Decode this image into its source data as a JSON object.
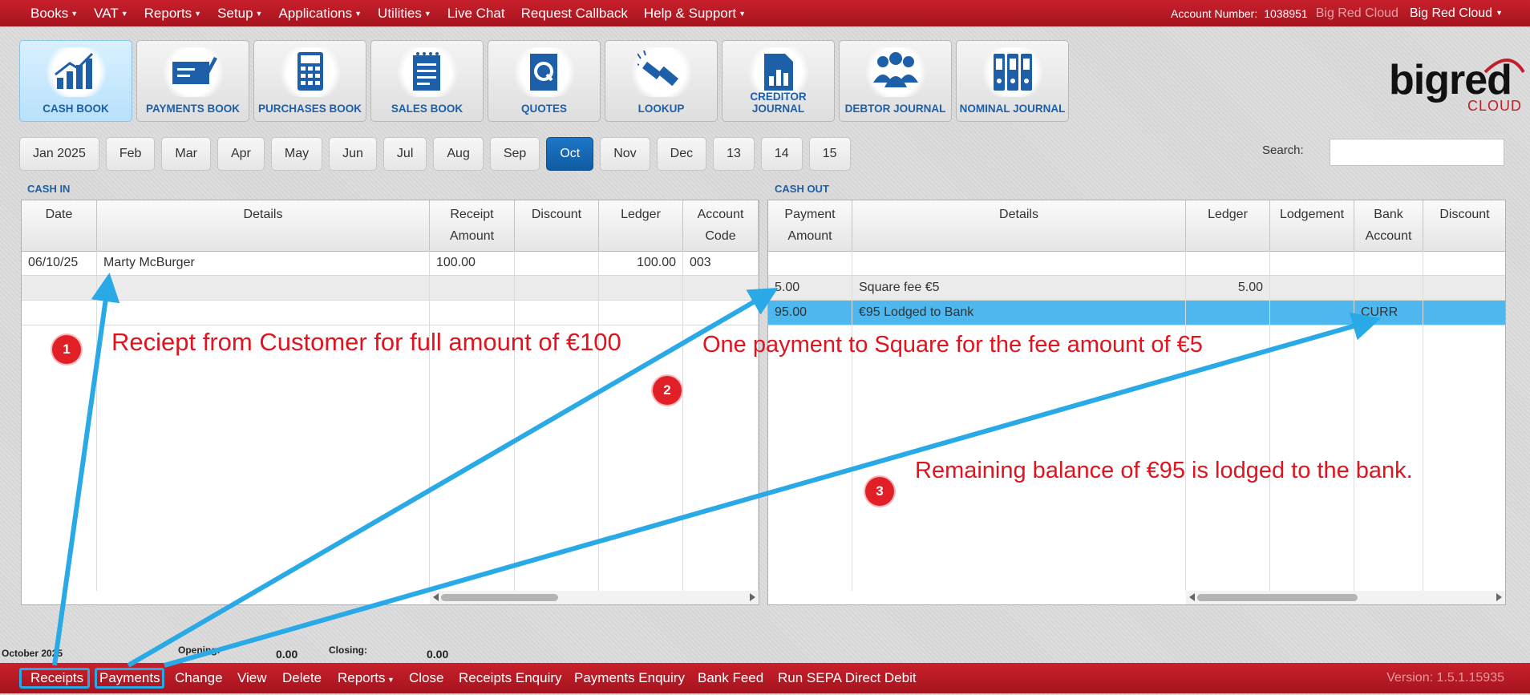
{
  "top_menu": [
    {
      "label": "Books",
      "dropdown": true
    },
    {
      "label": "VAT",
      "dropdown": true
    },
    {
      "label": "Reports",
      "dropdown": true
    },
    {
      "label": "Setup",
      "dropdown": true
    },
    {
      "label": "Applications",
      "dropdown": true
    },
    {
      "label": "Utilities",
      "dropdown": true
    },
    {
      "label": "Live Chat",
      "dropdown": false
    },
    {
      "label": "Request Callback",
      "dropdown": false
    },
    {
      "label": "Help & Support",
      "dropdown": true
    }
  ],
  "account": {
    "number_label": "Account Number:",
    "number": "1038951",
    "company_faded": "Big Red Cloud",
    "company": "Big Red Cloud"
  },
  "books": [
    {
      "label": "CASH BOOK",
      "icon": "bar-chart-icon",
      "active": true
    },
    {
      "label": "PAYMENTS BOOK",
      "icon": "cheque-pen-icon",
      "active": false
    },
    {
      "label": "PURCHASES BOOK",
      "icon": "calculator-icon",
      "active": false
    },
    {
      "label": "SALES BOOK",
      "icon": "notepad-icon",
      "active": false
    },
    {
      "label": "QUOTES",
      "icon": "quote-document-icon",
      "active": false
    },
    {
      "label": "LOOKUP",
      "icon": "flashlight-icon",
      "active": false
    },
    {
      "label": "CREDITOR JOURNAL",
      "icon": "chart-document-icon",
      "active": false
    },
    {
      "label": "DEBTOR JOURNAL",
      "icon": "people-group-icon",
      "active": false
    },
    {
      "label": "NOMINAL JOURNAL",
      "icon": "binders-icon",
      "active": false
    }
  ],
  "logo": {
    "big": "bigred",
    "cloud": "CLOUD"
  },
  "months": [
    {
      "label": "Jan 2025"
    },
    {
      "label": "Feb"
    },
    {
      "label": "Mar"
    },
    {
      "label": "Apr"
    },
    {
      "label": "May"
    },
    {
      "label": "Jun"
    },
    {
      "label": "Jul"
    },
    {
      "label": "Aug"
    },
    {
      "label": "Sep"
    },
    {
      "label": "Oct",
      "active": true
    },
    {
      "label": "Nov"
    },
    {
      "label": "Dec"
    },
    {
      "label": "13"
    },
    {
      "label": "14"
    },
    {
      "label": "15"
    }
  ],
  "search": {
    "label": "Search:",
    "value": ""
  },
  "cash_in": {
    "title": "CASH IN",
    "columns": [
      "Date",
      "Details",
      "Receipt\nAmount",
      "Discount",
      "Ledger",
      "Account\nCode"
    ],
    "rows": [
      [
        "06/10/25",
        "Marty McBurger",
        "100.00",
        "",
        "100.00",
        "003"
      ],
      [
        "",
        "",
        "",
        "",
        "",
        ""
      ],
      [
        "",
        "",
        "",
        "",
        "",
        ""
      ]
    ]
  },
  "cash_out": {
    "title": "CASH OUT",
    "columns": [
      "Payment\nAmount",
      "Details",
      "Ledger",
      "Lodgement",
      "Bank\nAccount",
      "Discount"
    ],
    "rows": [
      [
        "",
        "",
        "",
        "",
        "",
        ""
      ],
      [
        "5.00",
        "Square fee €5",
        "5.00",
        "",
        "",
        ""
      ],
      [
        "95.00",
        "€95 Lodged to Bank",
        "",
        "",
        "CURR",
        ""
      ]
    ],
    "selected_row": 2
  },
  "footer": {
    "period": "October 2025",
    "opening_label": "Opening:",
    "opening": "0.00",
    "closing_label": "Closing:",
    "closing": "0.00"
  },
  "bottom_actions": [
    "Receipts",
    "Payments",
    "Change",
    "View",
    "Delete",
    "Reports",
    "Close",
    "Receipts Enquiry",
    "Payments Enquiry",
    "Bank Feed",
    "Run SEPA Direct Debit"
  ],
  "highlighted_actions": [
    "Receipts",
    "Payments"
  ],
  "version": "Version: 1.5.1.15935",
  "annotations": [
    {
      "badge": "1",
      "text": "Reciept from Customer for full amount of €100"
    },
    {
      "badge": "2",
      "text": "One payment to Square for the fee amount of €5"
    },
    {
      "badge": "3",
      "text": "Remaining balance of €95 is lodged to the bank."
    }
  ],
  "colors": {
    "brand_red": "#b71a24",
    "accent_blue": "#1d5fa8",
    "selected_row": "#4db7ee",
    "annotation_red": "#e0141e",
    "arrow_blue": "#29a9e6"
  }
}
